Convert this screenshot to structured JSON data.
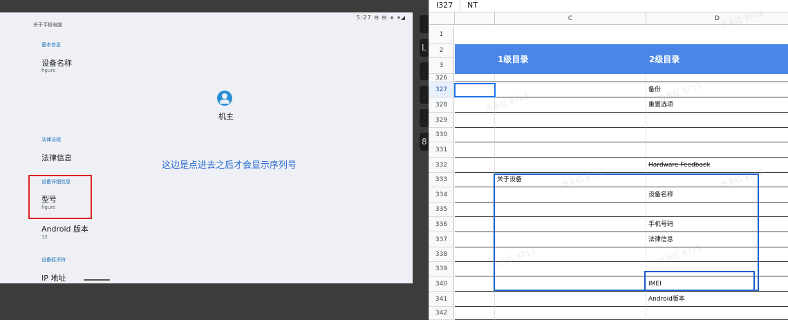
{
  "phone": {
    "status_bar": "5:27 ⊟ ⊟ ∗ ▾◢",
    "page_title": "关于平板电脑",
    "section_basic": "基本信息",
    "device_name_label": "设备名称",
    "device_name_value": "figure",
    "owner_label": "机主",
    "section_legal": "法律法规",
    "legal_info_label": "法律信息",
    "annotation": "这边是点进去之后才会显示序列号",
    "section_device_details": "设备详细信息",
    "model_label": "型号",
    "model_value": "figure",
    "android_version_label": "Android 版本",
    "android_version_value": "12",
    "section_device_ids": "设备标识符",
    "ip_label": "IP 地址"
  },
  "sheet": {
    "cell_ref": "I327",
    "formula_value": "NT",
    "columns": [
      "C",
      "D"
    ],
    "header_row_labels": [
      "1",
      "2",
      "3"
    ],
    "header_col_c": "1级目录",
    "header_col_d": "2级目录",
    "rows": [
      {
        "num": "326",
        "c": "",
        "d": ""
      },
      {
        "num": "327",
        "c": "",
        "d": "备份"
      },
      {
        "num": "328",
        "c": "",
        "d": "重置选项"
      },
      {
        "num": "329",
        "c": "",
        "d": ""
      },
      {
        "num": "330",
        "c": "",
        "d": ""
      },
      {
        "num": "331",
        "c": "",
        "d": ""
      },
      {
        "num": "332",
        "c": "",
        "d": "Hardware Feedback"
      },
      {
        "num": "333",
        "c": "关于设备",
        "d": ""
      },
      {
        "num": "334",
        "c": "",
        "d": "设备名称"
      },
      {
        "num": "335",
        "c": "",
        "d": ""
      },
      {
        "num": "336",
        "c": "",
        "d": "手机号码"
      },
      {
        "num": "337",
        "c": "",
        "d": "法律信息"
      },
      {
        "num": "338",
        "c": "",
        "d": ""
      },
      {
        "num": "339",
        "c": "",
        "d": ""
      },
      {
        "num": "340",
        "c": "",
        "d": "IMEI"
      },
      {
        "num": "341",
        "c": "",
        "d": "Android版本"
      },
      {
        "num": "342",
        "c": "",
        "d": ""
      }
    ],
    "watermark": "方永红 8713"
  },
  "strip": {
    "buttons": [
      "",
      "",
      "L",
      "",
      "",
      "",
      "",
      "8"
    ]
  }
}
